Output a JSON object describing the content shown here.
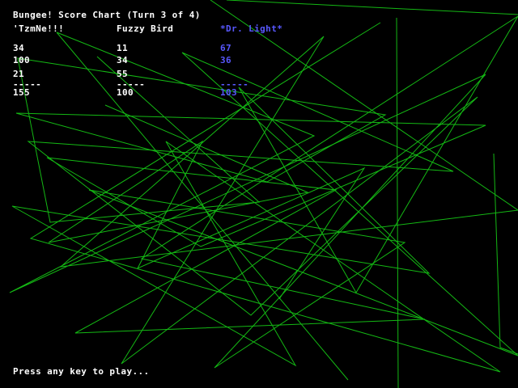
{
  "screen": {
    "title": "Bungee! Score Chart (Turn 3 of 4)",
    "prompt": "Press any key to play...",
    "colors": {
      "background": "#000000",
      "text": "#ffffff",
      "highlight_player": "#5858ff",
      "lines": "#14b814"
    }
  },
  "players": [
    {
      "name": "'TzmNe!!!",
      "scores": [
        "34",
        "100",
        "21"
      ],
      "separator": "-----",
      "total": "155",
      "highlighted": false
    },
    {
      "name": "Fuzzy Bird",
      "scores": [
        "11",
        "34",
        "55"
      ],
      "separator": "-----",
      "total": "100",
      "highlighted": false
    },
    {
      "name": "*Dr. Light*",
      "scores": [
        "67",
        "36",
        ""
      ],
      "separator": "-----",
      "total": "103",
      "highlighted": true
    }
  ]
}
